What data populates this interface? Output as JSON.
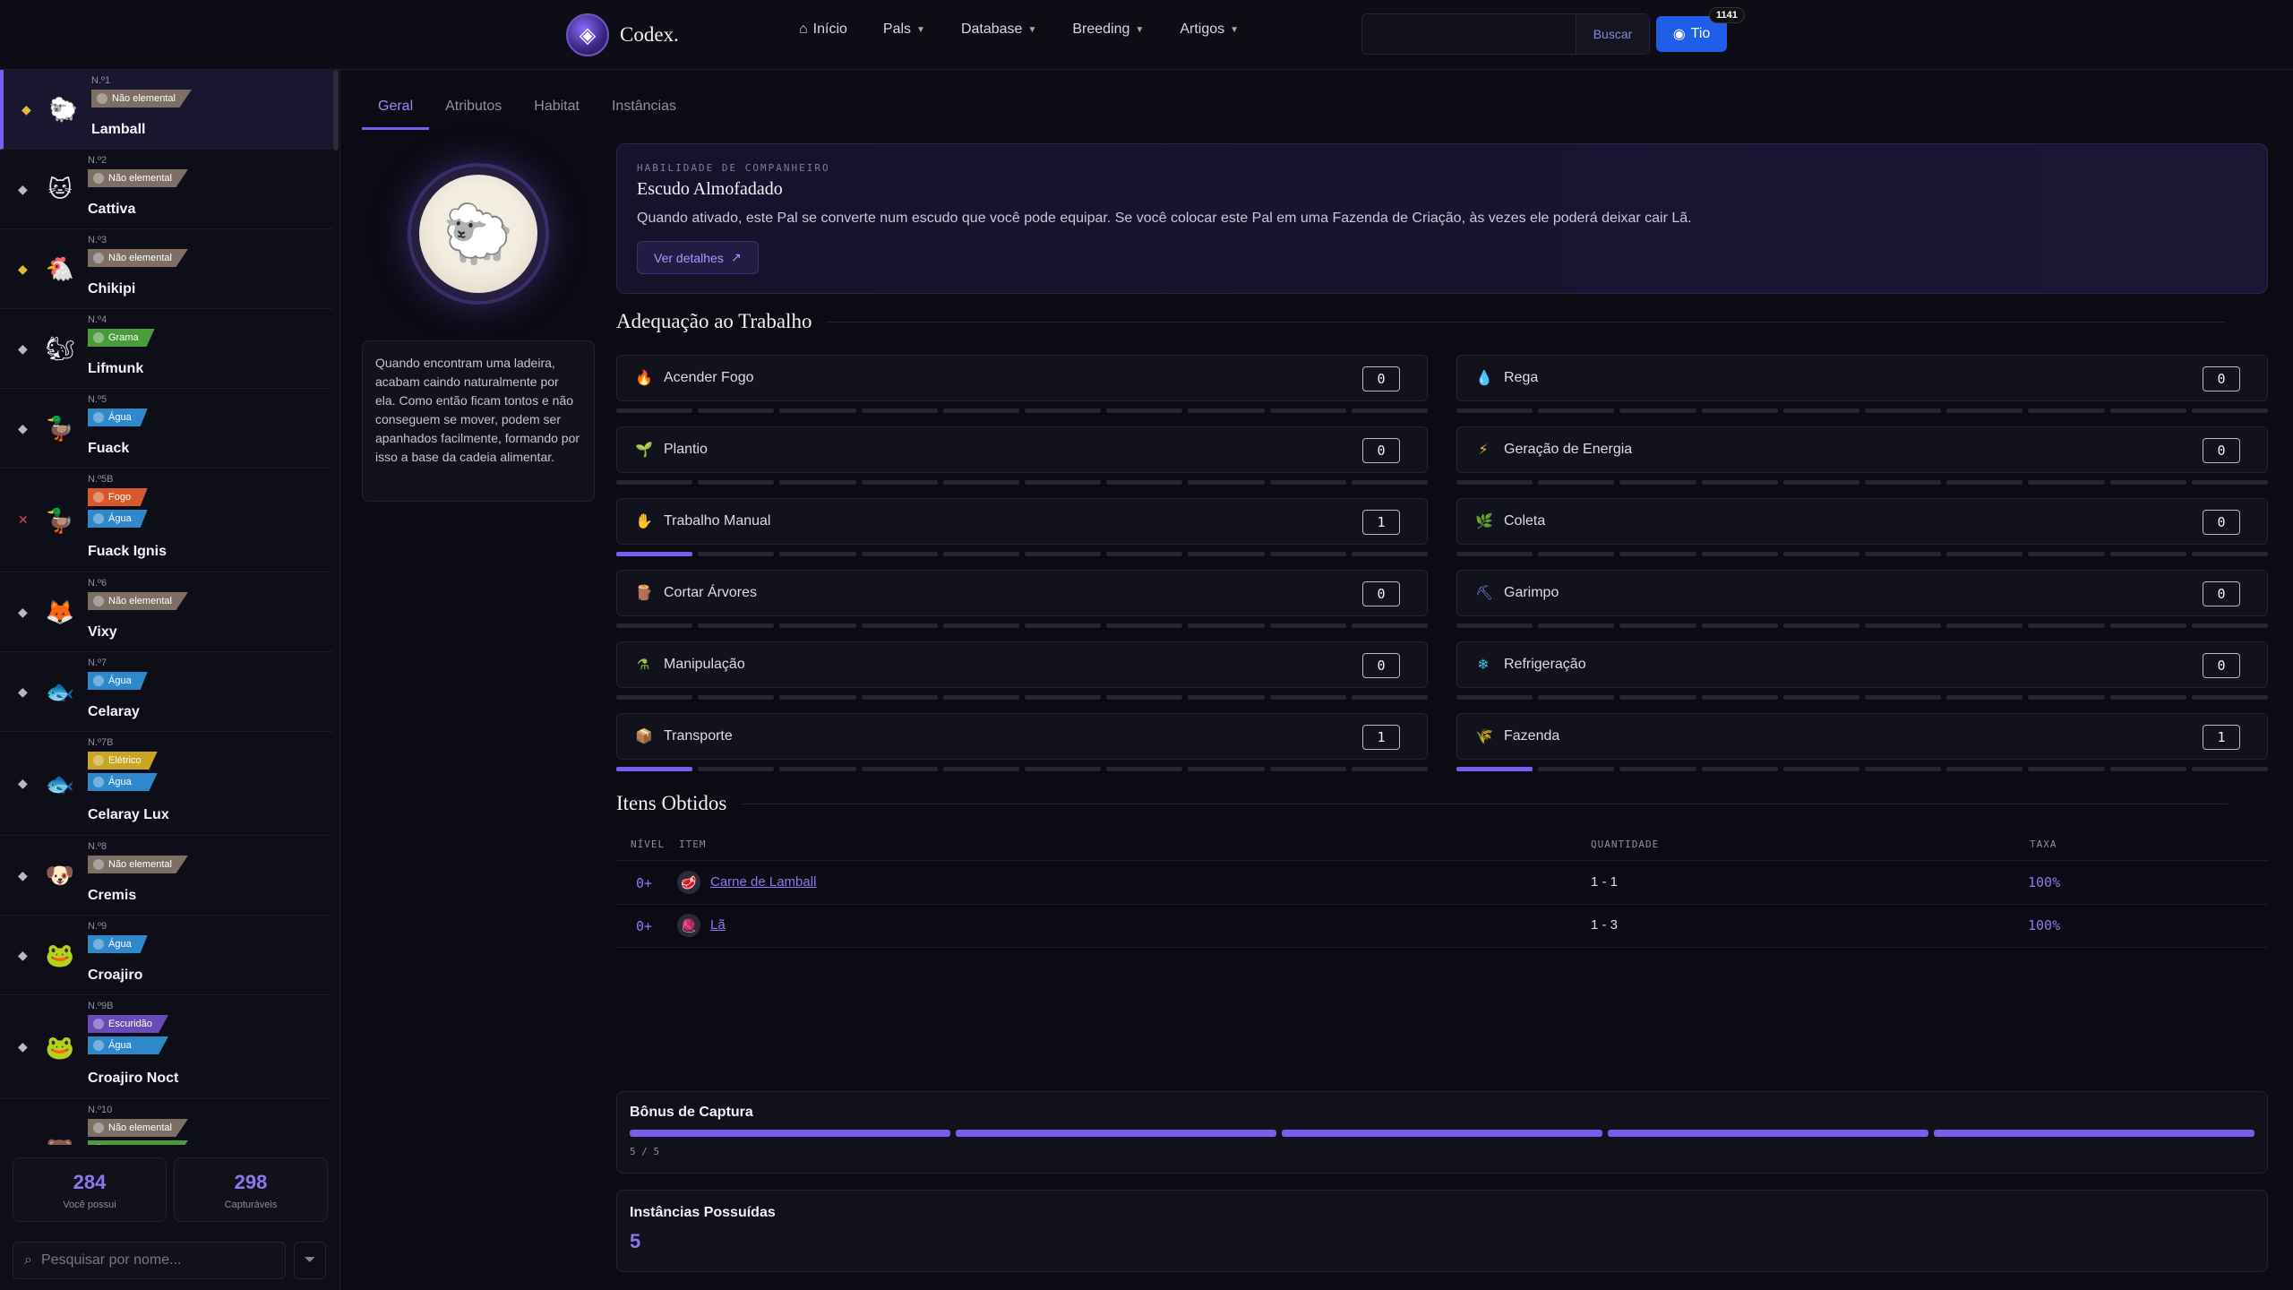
{
  "brand": {
    "name": "Codex."
  },
  "nav": [
    "Início",
    "Pals",
    "Database",
    "Breeding",
    "Artigos"
  ],
  "search": {
    "placeholder": "",
    "button": "Buscar"
  },
  "user": {
    "name": "Tio",
    "badge": "1141"
  },
  "pals": [
    {
      "num": "N.º1",
      "name": "Lamball",
      "types": [
        {
          "label": "Não elemental",
          "cls": "t-neutral"
        }
      ],
      "marker": "gold",
      "emoji": "🐑"
    },
    {
      "num": "N.º2",
      "name": "Cattiva",
      "types": [
        {
          "label": "Não elemental",
          "cls": "t-neutral"
        }
      ],
      "marker": "plain",
      "emoji": "🐱"
    },
    {
      "num": "N.º3",
      "name": "Chikipi",
      "types": [
        {
          "label": "Não elemental",
          "cls": "t-neutral"
        }
      ],
      "marker": "gold",
      "emoji": "🐔"
    },
    {
      "num": "N.º4",
      "name": "Lifmunk",
      "types": [
        {
          "label": "Grama",
          "cls": "t-grass"
        }
      ],
      "marker": "plain",
      "emoji": "🐿"
    },
    {
      "num": "N.º5",
      "name": "Fuack",
      "types": [
        {
          "label": "Água",
          "cls": "t-water"
        }
      ],
      "marker": "plain",
      "emoji": "🦆"
    },
    {
      "num": "N.º5B",
      "name": "Fuack Ignis",
      "types": [
        {
          "label": "Fogo",
          "cls": "t-fire"
        },
        {
          "label": "Água",
          "cls": "t-water"
        }
      ],
      "marker": "red",
      "emoji": "🦆"
    },
    {
      "num": "N.º6",
      "name": "Vixy",
      "types": [
        {
          "label": "Não elemental",
          "cls": "t-neutral"
        }
      ],
      "marker": "plain",
      "emoji": "🦊"
    },
    {
      "num": "N.º7",
      "name": "Celaray",
      "types": [
        {
          "label": "Água",
          "cls": "t-water"
        }
      ],
      "marker": "plain",
      "emoji": "🐟"
    },
    {
      "num": "N.º7B",
      "name": "Celaray Lux",
      "types": [
        {
          "label": "Elétrico",
          "cls": "t-elec"
        },
        {
          "label": "Água",
          "cls": "t-water"
        }
      ],
      "marker": "plain",
      "emoji": "🐟"
    },
    {
      "num": "N.º8",
      "name": "Cremis",
      "types": [
        {
          "label": "Não elemental",
          "cls": "t-neutral"
        }
      ],
      "marker": "plain",
      "emoji": "🐶"
    },
    {
      "num": "N.º9",
      "name": "Croajiro",
      "types": [
        {
          "label": "Água",
          "cls": "t-water"
        }
      ],
      "marker": "plain",
      "emoji": "🐸"
    },
    {
      "num": "N.º9B",
      "name": "Croajiro Noct",
      "types": [
        {
          "label": "Escuridão",
          "cls": "t-dark"
        },
        {
          "label": "Água",
          "cls": "t-water"
        }
      ],
      "marker": "plain",
      "emoji": "🐸"
    },
    {
      "num": "N.º10",
      "name": "",
      "types": [
        {
          "label": "Não elemental",
          "cls": "t-neutral"
        },
        {
          "label": "",
          "cls": "t-grass"
        }
      ],
      "marker": "plain",
      "emoji": "🐻"
    }
  ],
  "stats": {
    "owned": "284",
    "owned_label": "Você possui",
    "capturable": "298",
    "capturable_label": "Capturáveis"
  },
  "sidebar_search": {
    "placeholder": "Pesquisar por nome..."
  },
  "tabs": [
    "Geral",
    "Atributos",
    "Habitat",
    "Instâncias"
  ],
  "description": "Quando encontram uma ladeira, acabam caindo naturalmente por ela. Como então ficam tontos e não conseguem se mover, podem ser apanhados facilmente, formando por isso a base da cadeia alimentar.",
  "ability": {
    "kicker": "HABILIDADE DE COMPANHEIRO",
    "name": "Escudo Almofadado",
    "description": "Quando ativado, este Pal se converte num escudo que você pode equipar. Se você colocar este Pal em uma Fazenda de Criação, às vezes ele poderá deixar cair Lã.",
    "button": "Ver detalhes"
  },
  "work_title": "Adequação ao Trabalho",
  "work": [
    {
      "name": "Acender Fogo",
      "value": "0",
      "level": 0,
      "icon": "🔥",
      "icon_name": "fire-icon",
      "color": "#e0502e"
    },
    {
      "name": "Rega",
      "value": "0",
      "level": 0,
      "icon": "💧",
      "icon_name": "water-icon",
      "color": "#2ab0e0"
    },
    {
      "name": "Plantio",
      "value": "0",
      "level": 0,
      "icon": "🌱",
      "icon_name": "sprout-icon",
      "color": "#5ac04a"
    },
    {
      "name": "Geração de Energia",
      "value": "0",
      "level": 0,
      "icon": "⚡",
      "icon_name": "bolt-icon",
      "color": "#e0c030"
    },
    {
      "name": "Trabalho Manual",
      "value": "1",
      "level": 1,
      "icon": "✋",
      "icon_name": "hand-icon",
      "color": "#d8b070"
    },
    {
      "name": "Coleta",
      "value": "0",
      "level": 0,
      "icon": "🌿",
      "icon_name": "leaf-icon",
      "color": "#5ac04a"
    },
    {
      "name": "Cortar Árvores",
      "value": "0",
      "level": 0,
      "icon": "🪵",
      "icon_name": "log-icon",
      "color": "#b07040"
    },
    {
      "name": "Garimpo",
      "value": "0",
      "level": 0,
      "icon": "⛏",
      "icon_name": "pickaxe-icon",
      "color": "#8090e0"
    },
    {
      "name": "Manipulação",
      "value": "0",
      "level": 0,
      "icon": "⚗",
      "icon_name": "flask-icon",
      "color": "#90c050"
    },
    {
      "name": "Refrigeração",
      "value": "0",
      "level": 0,
      "icon": "❄",
      "icon_name": "snowflake-icon",
      "color": "#40c0e0"
    },
    {
      "name": "Transporte",
      "value": "1",
      "level": 1,
      "icon": "📦",
      "icon_name": "box-icon",
      "color": "#c08850"
    },
    {
      "name": "Fazenda",
      "value": "1",
      "level": 1,
      "icon": "🌾",
      "icon_name": "farm-icon",
      "color": "#d09060"
    }
  ],
  "items_title": "Itens Obtidos",
  "items_headers": {
    "level": "NÍVEL",
    "item": "ITEM",
    "qty": "QUANTIDADE",
    "rate": "TAXA"
  },
  "items": [
    {
      "level": "0+",
      "name": "Carne de Lamball",
      "qty": "1 - 1",
      "rate": "100%",
      "icon": "🥩"
    },
    {
      "level": "0+",
      "name": "Lã",
      "qty": "1 - 3",
      "rate": "100%",
      "icon": "🧶"
    }
  ],
  "capture": {
    "title": "Bônus de Captura",
    "progress": "5 / 5",
    "filled": 5,
    "total": 5
  },
  "instances": {
    "title": "Instâncias Possuídas",
    "count": "5"
  }
}
